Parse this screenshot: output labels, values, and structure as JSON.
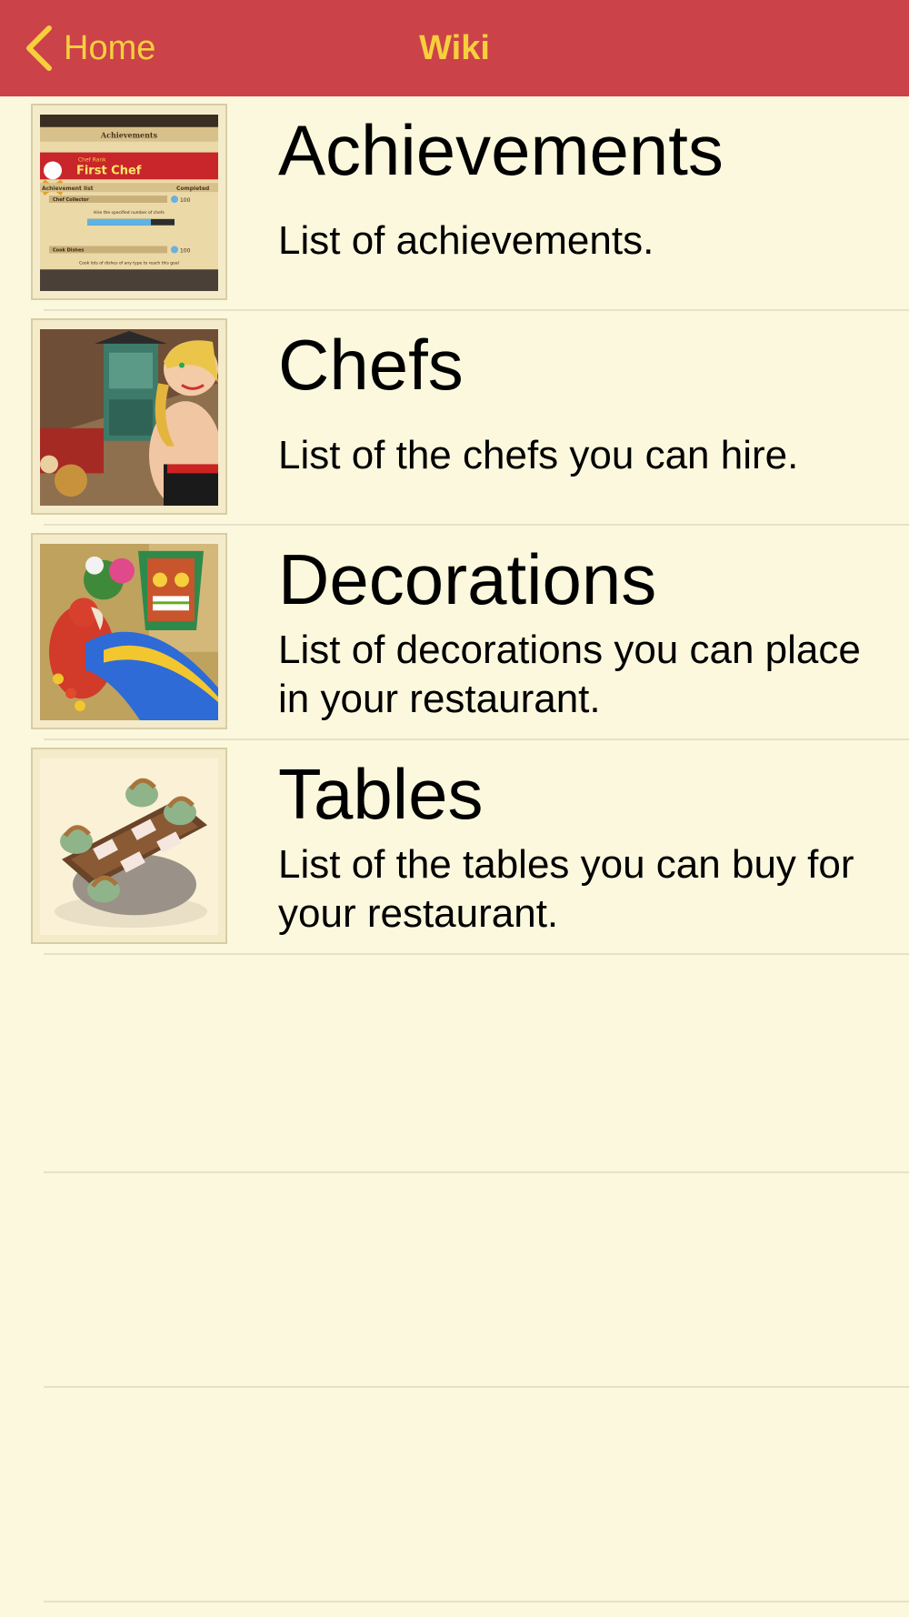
{
  "nav": {
    "back_label": "Home",
    "title": "Wiki",
    "accent_color": "#F6CF3D",
    "bar_color": "#CC4249"
  },
  "items": [
    {
      "title": "Achievements",
      "description": "List of achievements.",
      "thumbnail": {
        "icon": "achievements-screenshot",
        "header_label": "Achievements",
        "banner_small": "Chef Rank",
        "banner": "First Chef",
        "list_header_left": "Achievement list",
        "list_header_right": "Completed",
        "entry_1": "Chef Collector",
        "entry_1_value": "100",
        "entry_1_hint": "Hire the specified number of chefs",
        "entry_2": "Cook Dishes",
        "entry_2_value": "100",
        "entry_2_hint": "Cook lots of dishes of any type to reach this goal"
      }
    },
    {
      "title": "Chefs",
      "description": "List of the chefs you can hire.",
      "thumbnail": {
        "icon": "chef-portrait"
      }
    },
    {
      "title": "Decorations",
      "description": "List of decorations you can place in your restaurant.",
      "thumbnail": {
        "icon": "parrot-tiki-decoration"
      }
    },
    {
      "title": "Tables",
      "description": "List of the tables you can buy for your restaurant.",
      "thumbnail": {
        "icon": "dining-table"
      }
    }
  ]
}
